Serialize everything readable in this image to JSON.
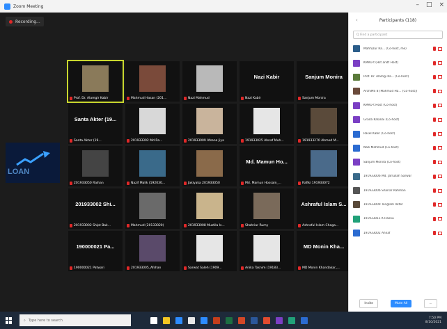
{
  "window": {
    "title": "Zoom Meeting"
  },
  "gallery": {
    "recording_label": "Recording...",
    "tiles": [
      {
        "label": "Prof. Dr. Alamgir Kabir",
        "big": "",
        "pic": "#8a7a5a"
      },
      {
        "label": "Mahmud Hasan (201...",
        "big": "",
        "pic": "#7a4a3a"
      },
      {
        "label": "Nazi Mahmud",
        "big": "",
        "pic": "#b9b9b9"
      },
      {
        "label": "Nazi Kabir",
        "big": "Nazi Kabir",
        "pic": ""
      },
      {
        "label": "Sanjum Monira",
        "big": "Sanjum Monira",
        "pic": ""
      },
      {
        "label": "Santa Akter (19...",
        "big": "Santa Akter (19...",
        "pic": ""
      },
      {
        "label": "201933302 Md Ra...",
        "big": "",
        "pic": "#d8d8d8"
      },
      {
        "label": "201933009 Afsana Jiya",
        "big": "",
        "pic": "#c9b49c"
      },
      {
        "label": "191933025 Ahnaf Muh...",
        "big": "",
        "pic": "#e6e6e6"
      },
      {
        "label": "191933270 Ahmed M...",
        "big": "",
        "pic": "#5a4a3a"
      },
      {
        "label": "201933050 Raihan",
        "big": "",
        "pic": "#444444"
      },
      {
        "label": "Nazif Malik (192030...",
        "big": "",
        "pic": "#3a6a8a"
      },
      {
        "label": "Jakiyaka 201933050",
        "big": "",
        "pic": "#8a6a4a"
      },
      {
        "label": "Md. Mamun Hossain_...",
        "big": "Md. Mamun Ho...",
        "pic": ""
      },
      {
        "label": "Rafiki 191933072",
        "big": "",
        "pic": "#4a6a8a"
      },
      {
        "label": "201933002 Shipt Bak...",
        "big": "201933002 Shi...",
        "pic": ""
      },
      {
        "label": "Mahmud (20133020)",
        "big": "",
        "pic": "#6a6a6a"
      },
      {
        "label": "201933008 Mustila Is...",
        "big": "",
        "pic": "#c9b48c"
      },
      {
        "label": "Shahriar Rumy",
        "big": "",
        "pic": "#7a6a5a"
      },
      {
        "label": "Ashraful Islam Chaga...",
        "big": "Ashraful Islam S...",
        "pic": ""
      },
      {
        "label": "190000021 Patwari",
        "big": "190000021 Pa...",
        "pic": ""
      },
      {
        "label": "201933005_Afshan",
        "big": "",
        "pic": "#5a4a6a"
      },
      {
        "label": "Sarwat Saleh (1909...",
        "big": "",
        "pic": "#e6e6e6"
      },
      {
        "label": "Anika Tasnim (19183...",
        "big": "",
        "pic": "#e6e6e6"
      },
      {
        "label": "MD Monin Khandakar_...",
        "big": "MD Monin Kha...",
        "pic": ""
      }
    ],
    "share_text": "LOAN"
  },
  "participants": {
    "title": "Participants (118)",
    "search_placeholder": "Q Find a participant",
    "rows": [
      {
        "name": "Mahfuzur Ra... (Co-host, me)",
        "av": "#2b5d8a"
      },
      {
        "name": "KMRU-t (Hst andt Host)",
        "av": "#7b3fc4"
      },
      {
        "name": "Prof. Dr. Alamgi Ka... (Co-host)",
        "av": "#5a7a3a"
      },
      {
        "name": "ArchiMS 8 (Mahmud Ha... (Co-host))",
        "av": "#6a4a3a"
      },
      {
        "name": "KMRU-t Host (Co-host)",
        "av": "#7b3fc4"
      },
      {
        "name": "Grada Kalanai (Co-host)",
        "av": "#7b3fc4"
      },
      {
        "name": "Rasel Kabir (Co-host)",
        "av": "#2b6bd1"
      },
      {
        "name": "Nazi Mahmud (Co-host)",
        "av": "#2b6bd1"
      },
      {
        "name": "Sanjum Monira (Co-host)",
        "av": "#7b3fc4"
      },
      {
        "name": "191933006 Md. Jafrullah Sarwar",
        "av": "#3a6a8a"
      },
      {
        "name": "191933006 Shariar Rahman",
        "av": "#555555"
      },
      {
        "name": "191933009 Tanglam Akter",
        "av": "#5a4a3a"
      },
      {
        "name": "191933011 K Hasnu",
        "av": "#21a179"
      },
      {
        "name": "191933002 Ahnaf",
        "av": "#2b6bd1"
      }
    ],
    "invite_label": "Invite",
    "mute_all_label": "Mute All",
    "more_label": "..."
  },
  "taskbar": {
    "search_placeholder": "Type here to search",
    "time": "7:50 PM",
    "date": "8/10/2021"
  }
}
